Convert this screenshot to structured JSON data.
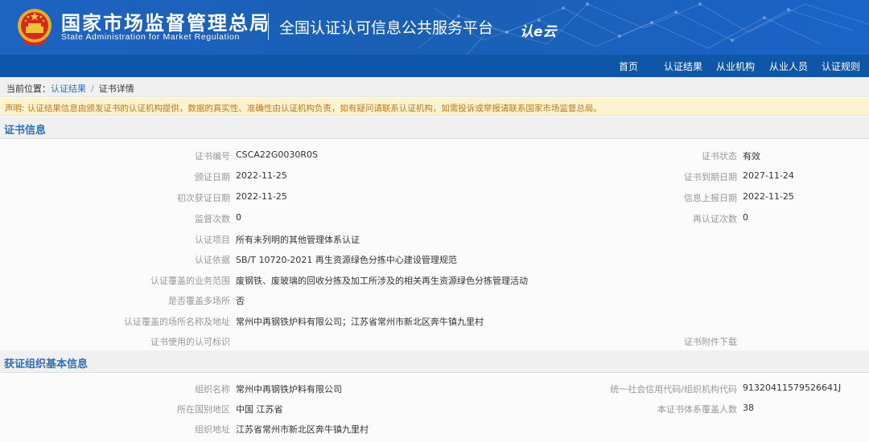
{
  "header": {
    "brand_cn": "国家市场监督管理总局",
    "brand_en": "State Administration  for  Market Regulation",
    "platform_title": "全国认证认可信息公共服务平台",
    "platform_logo_text": "认e云"
  },
  "nav": {
    "items": [
      {
        "label": "首页"
      },
      {
        "label": "认证结果"
      },
      {
        "label": "从业机构"
      },
      {
        "label": "从业人员"
      },
      {
        "label": "认证规则"
      }
    ]
  },
  "breadcrumb": {
    "prefix": "当前位置：",
    "level1": "认证结果",
    "separator": "/",
    "level2": "证书详情"
  },
  "notice": "声明: 认证结果信息由颁发证书的认证机构提供，数据的真实性、准确性由认证机构负责，如有疑问请联系认证机构，如需投诉或举报请联系国家市场监督总局。",
  "cert_section": {
    "title": "证书信息",
    "fields": {
      "cert_no_label": "证书编号",
      "cert_no": "CSCA22G0030R0S",
      "cert_status_label": "证书状态",
      "cert_status": "有效",
      "issue_date_label": "颁证日期",
      "issue_date": "2022-11-25",
      "expiry_date_label": "证书到期日期",
      "expiry_date": "2027-11-24",
      "first_date_label": "初次获证日期",
      "first_date": "2022-11-25",
      "report_date_label": "信息上报日期",
      "report_date": "2022-11-25",
      "supervision_label": "监督次数",
      "supervision": "0",
      "recert_label": "再认证次数",
      "recert": "0",
      "project_label": "认证项目",
      "project": "所有未列明的其他管理体系认证",
      "basis_label": "认证依据",
      "basis": "SB/T 10720-2021 再生资源绿色分拣中心建设管理规范",
      "scope_label": "认证覆盖的业务范围",
      "scope": "废钢铁、废玻璃的回收分拣及加工所涉及的相关再生资源绿色分拣管理活动",
      "multisite_label": "是否覆盖多场所",
      "multisite": "否",
      "site_label": "认证覆盖的场所名称及地址",
      "site": "常州中再钢铁炉料有限公司；江苏省常州市新北区奔牛镇九里村",
      "mark_label": "证书使用的认可标识",
      "attachment_label": "证书附件下载"
    }
  },
  "org_section": {
    "title": "获证组织基本信息",
    "fields": {
      "org_name_label": "组织名称",
      "org_name": "常州中再钢铁炉料有限公司",
      "credit_code_label": "统一社会信用代码/组织机构代码",
      "credit_code": "91320411579526641J",
      "region_label": "所在国别地区",
      "region": "中国 江苏省",
      "people_label": "本证书体系覆盖人数",
      "people": "38",
      "address_label": "组织地址",
      "address": "江苏省常州市新北区奔牛镇九里村"
    }
  },
  "colors": {
    "header_blue": "#1a5fb4",
    "nav_blue": "#0e57a8",
    "link_blue": "#2f6fbf",
    "notice_text": "#c8751a",
    "notice_bg": "#fbf3d0"
  }
}
